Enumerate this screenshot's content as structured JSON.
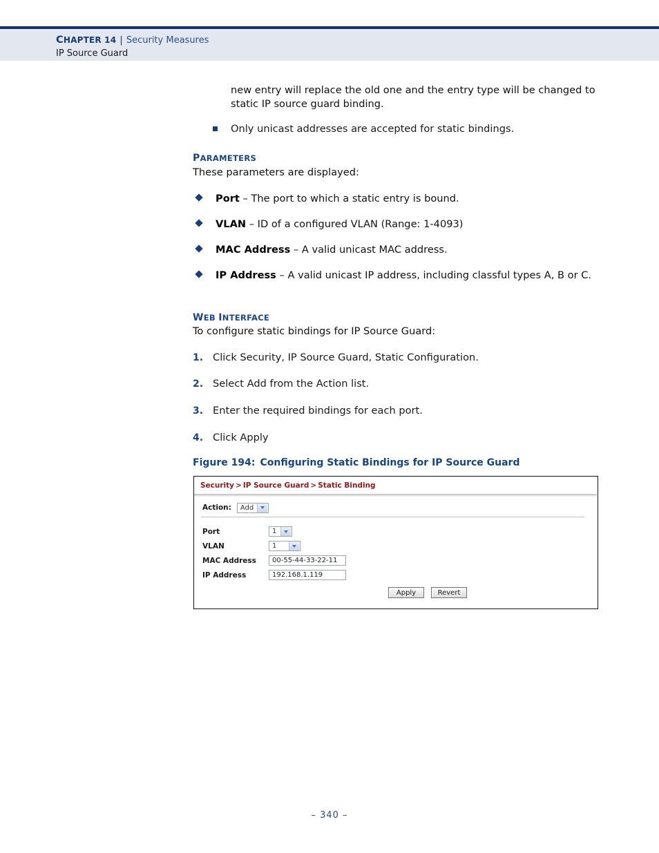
{
  "header": {
    "chapter_label": "Chapter 14",
    "separator": "|",
    "subject": "Security Measures",
    "section": "IP Source Guard"
  },
  "body": {
    "intro_paragraph": "new entry will replace the old one and the entry type will be changed to static IP source guard binding.",
    "square_bullets": [
      "Only unicast addresses are accepted for static bindings."
    ],
    "parameters_heading": "Parameters",
    "parameters_lead": "These parameters are displayed:",
    "parameters": [
      {
        "term": "Port",
        "desc": " – The port to which a static entry is bound."
      },
      {
        "term": "VLAN",
        "desc": " – ID of a configured VLAN (Range: 1-4093)"
      },
      {
        "term": "MAC Address",
        "desc": " – A valid unicast MAC address."
      },
      {
        "term": "IP Address",
        "desc": " – A valid unicast IP address, including classful types A, B or C."
      }
    ],
    "web_interface_heading": "Web Interface",
    "web_interface_lead": "To configure static bindings for IP Source Guard:",
    "steps": [
      {
        "num": "1.",
        "text": "Click Security, IP Source Guard, Static Configuration."
      },
      {
        "num": "2.",
        "text": "Select Add from the Action list."
      },
      {
        "num": "3.",
        "text": "Enter the required bindings for each port."
      },
      {
        "num": "4.",
        "text": "Click Apply"
      }
    ]
  },
  "figure": {
    "caption_number": "Figure 194:",
    "caption_title": "Configuring Static Bindings for IP Source Guard",
    "breadcrumb": [
      "Security",
      "IP Source Guard",
      "Static Binding"
    ],
    "breadcrumb_separator": ">",
    "action_label": "Action:",
    "action_value": "Add",
    "fields": [
      {
        "label": "Port",
        "value": "1",
        "kind": "select"
      },
      {
        "label": "VLAN",
        "value": "1",
        "kind": "select"
      },
      {
        "label": "MAC Address",
        "value": "00-55-44-33-22-11",
        "kind": "text"
      },
      {
        "label": "IP Address",
        "value": "192.168.1.119",
        "kind": "text"
      }
    ],
    "buttons": [
      {
        "label": "Apply"
      },
      {
        "label": "Revert"
      }
    ]
  },
  "footer": {
    "page_number": "–  340  –"
  },
  "colors": {
    "header_band": "#e3e7ef",
    "rule_navy": "#113370",
    "heading_blue": "#1c4585",
    "breadcrumb_red": "#8b1a1a",
    "bullet_navy": "#1c3c74"
  }
}
